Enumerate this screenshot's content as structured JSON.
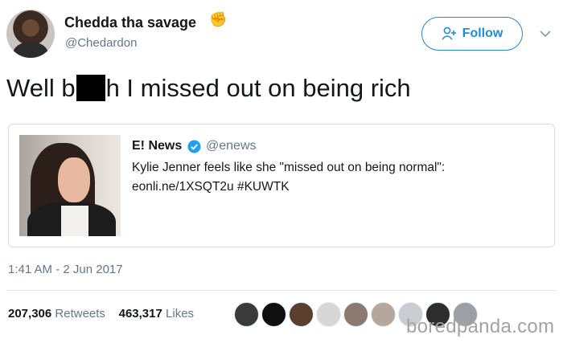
{
  "author": {
    "display_name": "Chedda tha savage",
    "name_emoji": "fist-emoji",
    "handle": "@Chedardon"
  },
  "follow_button": {
    "label": "Follow",
    "icon": "add-person-icon"
  },
  "tweet": {
    "text_before": "Well b",
    "text_after": "h I missed out on being rich"
  },
  "quoted": {
    "name": "E! News",
    "handle": "@enews",
    "line1": "Kylie Jenner feels like she \"missed out on being normal\":",
    "line2": "eonli.ne/1XSQT2u #KUWTK"
  },
  "timestamp": "1:41 AM - 2 Jun 2017",
  "stats": {
    "retweets_count": "207,306",
    "retweets_label": "Retweets",
    "likes_count": "463,317",
    "likes_label": "Likes"
  },
  "liker_colors": [
    "#3a3a3a",
    "#0f0f0f",
    "#5a3e2e",
    "#d7d7d7",
    "#8a7a70",
    "#b5a79b",
    "#c9ccd1",
    "#2d2d2d",
    "#9aa0a4"
  ],
  "watermark": "boredpanda.com",
  "colors": {
    "accent": "#1d8dd6",
    "secondary_text": "#657786",
    "verified": "#1da1f2"
  }
}
